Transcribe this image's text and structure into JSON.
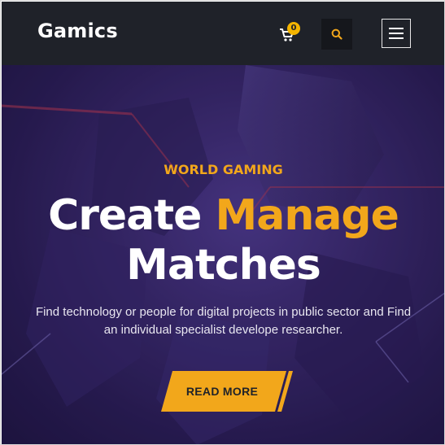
{
  "header": {
    "logo": "Gamics",
    "cart_count": "0",
    "icons": {
      "cart": "cart-icon",
      "search": "search-icon",
      "menu": "hamburger-menu-icon"
    }
  },
  "hero": {
    "kicker": "WORLD GAMING",
    "title_line1_part1": "Create",
    "title_line1_part2": "Manage",
    "title_line2": "Matches",
    "description": "Find technology or people for digital projects in public sector and Find an individual specialist develope researcher.",
    "cta_label": "READ MORE"
  },
  "colors": {
    "nav_bg": "#1f2229",
    "accent": "#f2a71b",
    "hero_bg": "#2f2260",
    "text": "#ffffff"
  }
}
